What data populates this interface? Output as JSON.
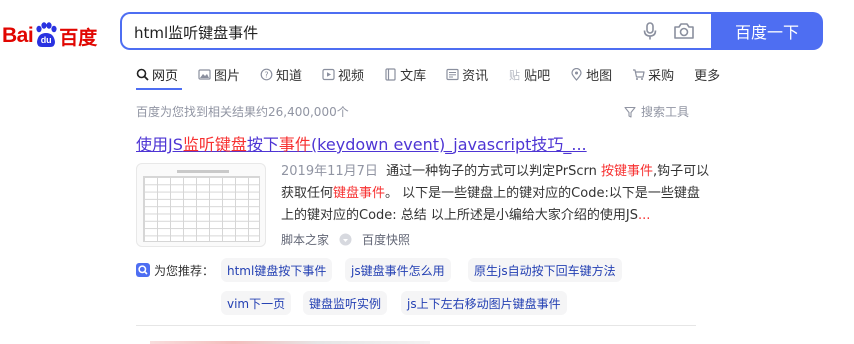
{
  "logo": {
    "left_text": "Bai",
    "badge_text": "du",
    "right_text": "百度",
    "brand_color": "#e10601"
  },
  "search": {
    "query": "html监听键盘事件",
    "button_label": "百度一下",
    "mic_icon": "microphone-icon",
    "camera_icon": "camera-icon",
    "accent": "#4e6ef2"
  },
  "tabs": [
    {
      "label": "网页",
      "icon": "search-icon",
      "active": true
    },
    {
      "label": "图片",
      "icon": "image-icon"
    },
    {
      "label": "知道",
      "icon": "question-icon"
    },
    {
      "label": "视频",
      "icon": "play-icon"
    },
    {
      "label": "文库",
      "icon": "book-icon"
    },
    {
      "label": "资讯",
      "icon": "news-icon"
    },
    {
      "label": "贴吧",
      "icon": "tieba-icon"
    },
    {
      "label": "地图",
      "icon": "map-pin-icon"
    },
    {
      "label": "采购",
      "icon": "cart-icon"
    },
    {
      "label": "更多"
    }
  ],
  "result_count": "百度为您找到相关结果约26,400,000个",
  "search_tools": "搜索工具",
  "result": {
    "title_prefix": "使用JS",
    "title_hl": "监听键盘",
    "title_mid": "按下",
    "title_hl2": "事件",
    "title_suffix": "(keydown event)_javascript技巧_...",
    "date": "2019年11月7日",
    "snippet_l1_a": "通过一种钩子的方式可以判定PrScrn ",
    "snippet_l1_hl": "按键事件",
    "snippet_l1_b": ",钩子可以",
    "snippet_l2_a": "获取任何",
    "snippet_l2_hl": "键盘事件",
    "snippet_l2_b": "。 以下是一些键盘上的键对应的Code:以下是一些键盘",
    "snippet_l3_a": "上的键对应的Code: 总结 以上所述是小编给大家介绍的使用JS",
    "snippet_l3_more": "...",
    "source": "脚本之家",
    "snapshot": "百度快照"
  },
  "recommend": {
    "label": "为您推荐：",
    "items": [
      "html键盘按下事件",
      "js键盘事件怎么用",
      "原生js自动按下回车键方法",
      "vim下一页",
      "键盘监听实例",
      "js上下左右移动图片键盘事件"
    ]
  },
  "colors": {
    "link": "#4e35d4",
    "highlight": "#f73131",
    "muted": "#9195a3",
    "chip_text": "#2440b3"
  }
}
